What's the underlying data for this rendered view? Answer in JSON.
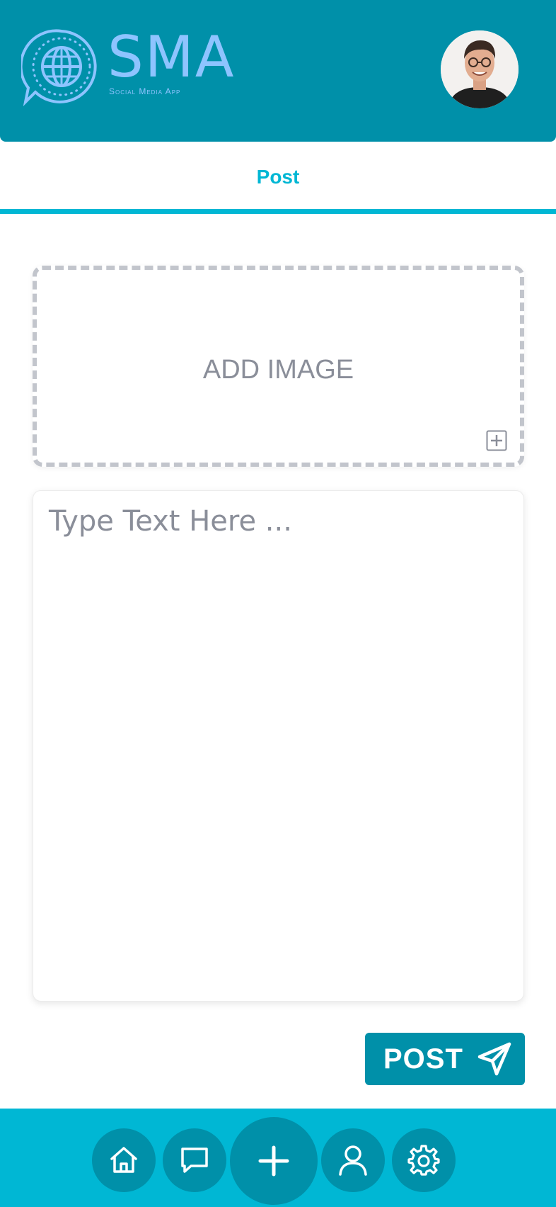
{
  "header": {
    "logo_title": "SMA",
    "logo_subtitle": "Social Media App",
    "avatar_alt": "User avatar"
  },
  "tab": {
    "label": "Post"
  },
  "dropzone": {
    "label": "ADD IMAGE"
  },
  "composer": {
    "placeholder": "Type Text Here ..."
  },
  "post_button": {
    "label": "POST",
    "icon": "send-icon"
  },
  "bottom_nav": {
    "items": [
      {
        "name": "home",
        "icon": "home-icon"
      },
      {
        "name": "messages",
        "icon": "chat-bubble-icon"
      },
      {
        "name": "create",
        "icon": "plus-icon"
      },
      {
        "name": "profile",
        "icon": "user-icon"
      },
      {
        "name": "settings",
        "icon": "gear-icon"
      }
    ]
  },
  "colors": {
    "header_bg": "#0090a9",
    "accent": "#00b7d4",
    "logo": "#8ec4ff",
    "muted_text": "#8a8e99"
  }
}
